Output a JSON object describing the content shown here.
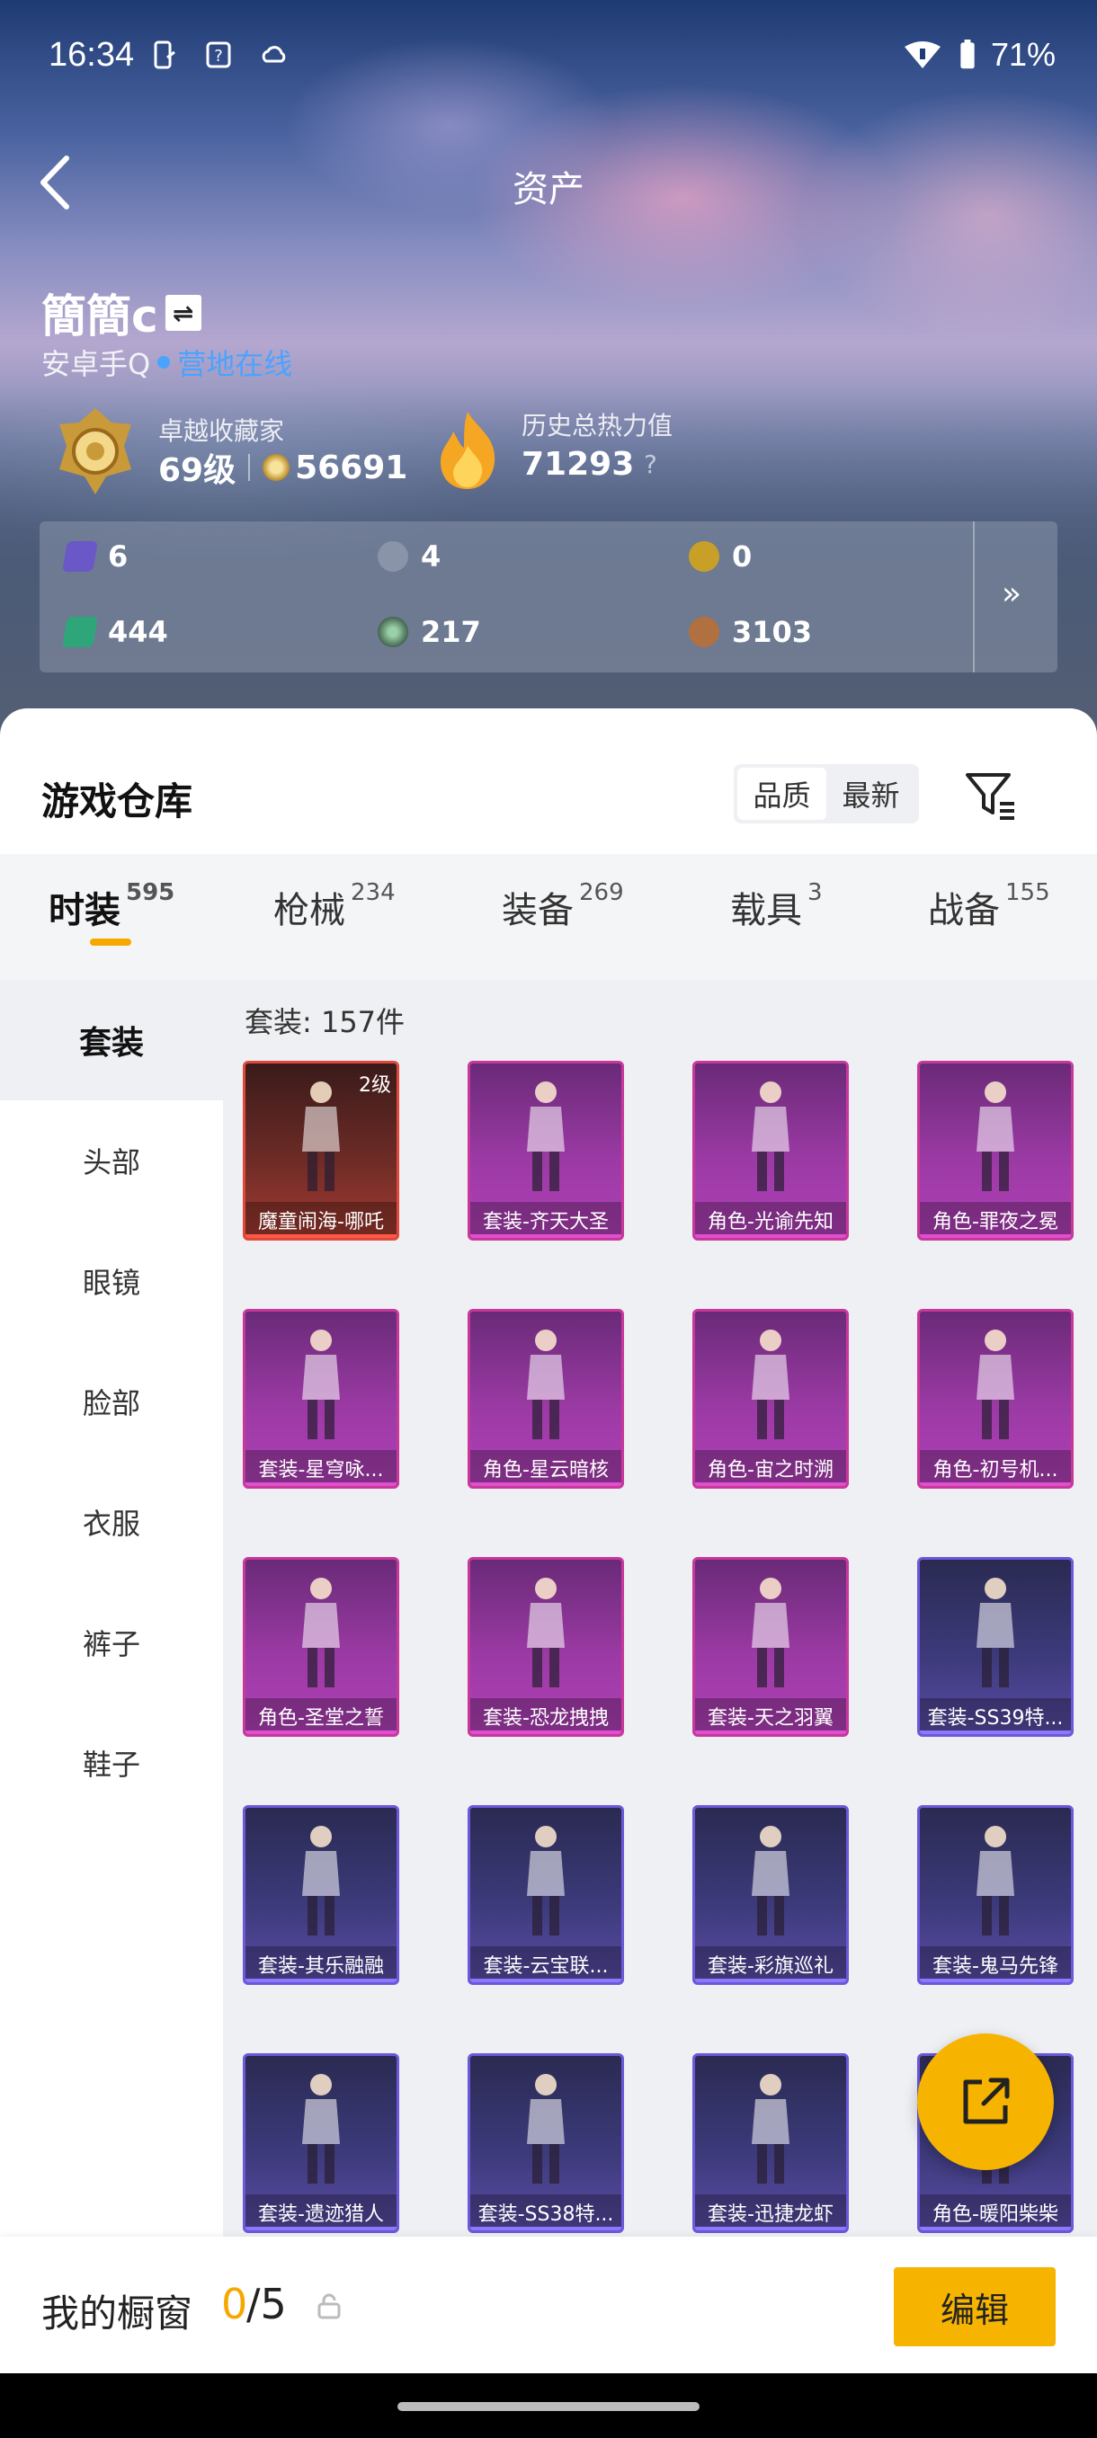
{
  "status_bar": {
    "time": "16:34",
    "battery": "71%"
  },
  "header": {
    "title": "资产"
  },
  "profile": {
    "username": "簡簡c",
    "swap_icon_text": "⇌",
    "platform": "安卓手Q",
    "online_status": "营地在线",
    "collector_label": "卓越收藏家",
    "level": "69级",
    "points": "56691",
    "heat_label": "历史总热力值",
    "heat_value": "71293",
    "heat_help": "?"
  },
  "resources": [
    {
      "icon": "purple-card-icon",
      "value": "6",
      "color": "#6a58c8"
    },
    {
      "icon": "silver-coin-icon",
      "value": "4",
      "color": "#8a94a8"
    },
    {
      "icon": "gold-coin-icon",
      "value": "0",
      "color": "#c8a028"
    },
    {
      "icon": "green-card-icon",
      "value": "444",
      "color": "#2ea67a"
    },
    {
      "icon": "green-orb-icon",
      "value": "217",
      "color": "#4a7a5a"
    },
    {
      "icon": "bronze-coin-icon",
      "value": "3103",
      "color": "#b07040"
    }
  ],
  "resources_more": "»",
  "warehouse": {
    "title": "游戏仓库",
    "sort_options": [
      "品质",
      "最新"
    ],
    "tabs": [
      {
        "label": "时装",
        "count": "595"
      },
      {
        "label": "枪械",
        "count": "234"
      },
      {
        "label": "装备",
        "count": "269"
      },
      {
        "label": "载具",
        "count": "3"
      },
      {
        "label": "战备",
        "count": "155"
      }
    ],
    "sidebar": [
      "套装",
      "头部",
      "眼镜",
      "脸部",
      "衣服",
      "裤子",
      "鞋子"
    ],
    "count_label": "套装: 157件",
    "items": [
      {
        "label": "魔童闹海-哪吒",
        "tier": "red",
        "level": "2级"
      },
      {
        "label": "套装-齐天大圣",
        "tier": "pur"
      },
      {
        "label": "角色-光谕先知",
        "tier": "pur"
      },
      {
        "label": "角色-罪夜之冕",
        "tier": "pur"
      },
      {
        "label": "套装-星穹咏...",
        "tier": "pur"
      },
      {
        "label": "角色-星云暗核",
        "tier": "pur"
      },
      {
        "label": "角色-宙之时溯",
        "tier": "pur"
      },
      {
        "label": "角色-初号机...",
        "tier": "pur"
      },
      {
        "label": "角色-圣堂之誓",
        "tier": "pur"
      },
      {
        "label": "套装-恐龙拽拽",
        "tier": "pur"
      },
      {
        "label": "套装-天之羽翼",
        "tier": "pur"
      },
      {
        "label": "套装-SS39特...",
        "tier": "blu"
      },
      {
        "label": "套装-其乐融融",
        "tier": "blu"
      },
      {
        "label": "套装-云宝联...",
        "tier": "blu"
      },
      {
        "label": "套装-彩旗巡礼",
        "tier": "blu"
      },
      {
        "label": "套装-鬼马先锋",
        "tier": "blu"
      },
      {
        "label": "套装-遗迹猎人",
        "tier": "blu"
      },
      {
        "label": "套装-SS38特...",
        "tier": "blu"
      },
      {
        "label": "套装-迅捷龙虾",
        "tier": "blu"
      },
      {
        "label": "角色-暖阳柴柴",
        "tier": "blu"
      }
    ]
  },
  "showcase": {
    "label": "我的橱窗",
    "current": "0",
    "total": "/5",
    "edit_label": "编辑"
  }
}
